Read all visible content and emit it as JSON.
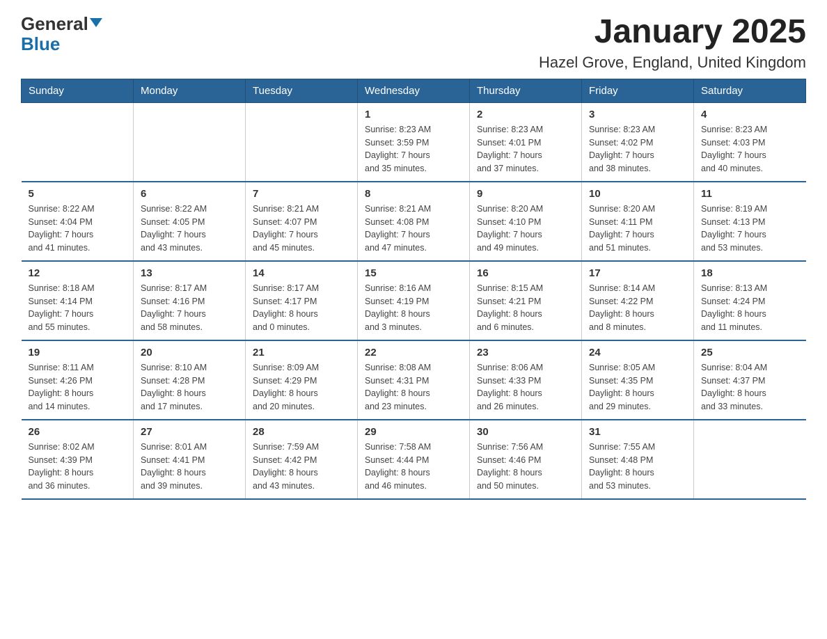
{
  "header": {
    "logo_general": "General",
    "logo_blue": "Blue",
    "title": "January 2025",
    "subtitle": "Hazel Grove, England, United Kingdom"
  },
  "weekdays": [
    "Sunday",
    "Monday",
    "Tuesday",
    "Wednesday",
    "Thursday",
    "Friday",
    "Saturday"
  ],
  "weeks": [
    [
      {
        "day": "",
        "info": ""
      },
      {
        "day": "",
        "info": ""
      },
      {
        "day": "",
        "info": ""
      },
      {
        "day": "1",
        "info": "Sunrise: 8:23 AM\nSunset: 3:59 PM\nDaylight: 7 hours\nand 35 minutes."
      },
      {
        "day": "2",
        "info": "Sunrise: 8:23 AM\nSunset: 4:01 PM\nDaylight: 7 hours\nand 37 minutes."
      },
      {
        "day": "3",
        "info": "Sunrise: 8:23 AM\nSunset: 4:02 PM\nDaylight: 7 hours\nand 38 minutes."
      },
      {
        "day": "4",
        "info": "Sunrise: 8:23 AM\nSunset: 4:03 PM\nDaylight: 7 hours\nand 40 minutes."
      }
    ],
    [
      {
        "day": "5",
        "info": "Sunrise: 8:22 AM\nSunset: 4:04 PM\nDaylight: 7 hours\nand 41 minutes."
      },
      {
        "day": "6",
        "info": "Sunrise: 8:22 AM\nSunset: 4:05 PM\nDaylight: 7 hours\nand 43 minutes."
      },
      {
        "day": "7",
        "info": "Sunrise: 8:21 AM\nSunset: 4:07 PM\nDaylight: 7 hours\nand 45 minutes."
      },
      {
        "day": "8",
        "info": "Sunrise: 8:21 AM\nSunset: 4:08 PM\nDaylight: 7 hours\nand 47 minutes."
      },
      {
        "day": "9",
        "info": "Sunrise: 8:20 AM\nSunset: 4:10 PM\nDaylight: 7 hours\nand 49 minutes."
      },
      {
        "day": "10",
        "info": "Sunrise: 8:20 AM\nSunset: 4:11 PM\nDaylight: 7 hours\nand 51 minutes."
      },
      {
        "day": "11",
        "info": "Sunrise: 8:19 AM\nSunset: 4:13 PM\nDaylight: 7 hours\nand 53 minutes."
      }
    ],
    [
      {
        "day": "12",
        "info": "Sunrise: 8:18 AM\nSunset: 4:14 PM\nDaylight: 7 hours\nand 55 minutes."
      },
      {
        "day": "13",
        "info": "Sunrise: 8:17 AM\nSunset: 4:16 PM\nDaylight: 7 hours\nand 58 minutes."
      },
      {
        "day": "14",
        "info": "Sunrise: 8:17 AM\nSunset: 4:17 PM\nDaylight: 8 hours\nand 0 minutes."
      },
      {
        "day": "15",
        "info": "Sunrise: 8:16 AM\nSunset: 4:19 PM\nDaylight: 8 hours\nand 3 minutes."
      },
      {
        "day": "16",
        "info": "Sunrise: 8:15 AM\nSunset: 4:21 PM\nDaylight: 8 hours\nand 6 minutes."
      },
      {
        "day": "17",
        "info": "Sunrise: 8:14 AM\nSunset: 4:22 PM\nDaylight: 8 hours\nand 8 minutes."
      },
      {
        "day": "18",
        "info": "Sunrise: 8:13 AM\nSunset: 4:24 PM\nDaylight: 8 hours\nand 11 minutes."
      }
    ],
    [
      {
        "day": "19",
        "info": "Sunrise: 8:11 AM\nSunset: 4:26 PM\nDaylight: 8 hours\nand 14 minutes."
      },
      {
        "day": "20",
        "info": "Sunrise: 8:10 AM\nSunset: 4:28 PM\nDaylight: 8 hours\nand 17 minutes."
      },
      {
        "day": "21",
        "info": "Sunrise: 8:09 AM\nSunset: 4:29 PM\nDaylight: 8 hours\nand 20 minutes."
      },
      {
        "day": "22",
        "info": "Sunrise: 8:08 AM\nSunset: 4:31 PM\nDaylight: 8 hours\nand 23 minutes."
      },
      {
        "day": "23",
        "info": "Sunrise: 8:06 AM\nSunset: 4:33 PM\nDaylight: 8 hours\nand 26 minutes."
      },
      {
        "day": "24",
        "info": "Sunrise: 8:05 AM\nSunset: 4:35 PM\nDaylight: 8 hours\nand 29 minutes."
      },
      {
        "day": "25",
        "info": "Sunrise: 8:04 AM\nSunset: 4:37 PM\nDaylight: 8 hours\nand 33 minutes."
      }
    ],
    [
      {
        "day": "26",
        "info": "Sunrise: 8:02 AM\nSunset: 4:39 PM\nDaylight: 8 hours\nand 36 minutes."
      },
      {
        "day": "27",
        "info": "Sunrise: 8:01 AM\nSunset: 4:41 PM\nDaylight: 8 hours\nand 39 minutes."
      },
      {
        "day": "28",
        "info": "Sunrise: 7:59 AM\nSunset: 4:42 PM\nDaylight: 8 hours\nand 43 minutes."
      },
      {
        "day": "29",
        "info": "Sunrise: 7:58 AM\nSunset: 4:44 PM\nDaylight: 8 hours\nand 46 minutes."
      },
      {
        "day": "30",
        "info": "Sunrise: 7:56 AM\nSunset: 4:46 PM\nDaylight: 8 hours\nand 50 minutes."
      },
      {
        "day": "31",
        "info": "Sunrise: 7:55 AM\nSunset: 4:48 PM\nDaylight: 8 hours\nand 53 minutes."
      },
      {
        "day": "",
        "info": ""
      }
    ]
  ]
}
